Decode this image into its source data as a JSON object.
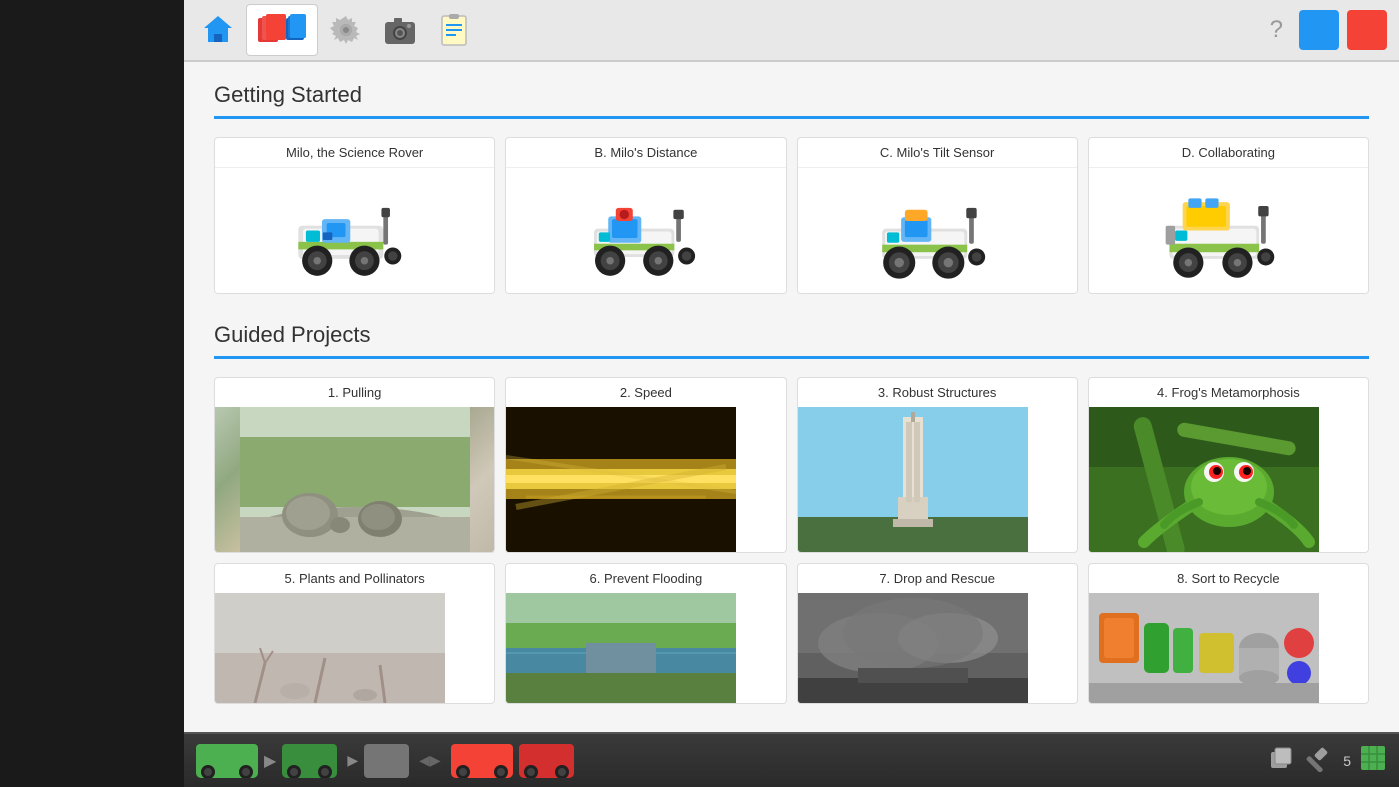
{
  "toolbar": {
    "icons": [
      "home",
      "book-open",
      "settings",
      "camera",
      "clipboard"
    ],
    "help_label": "?",
    "blue_button_label": "",
    "red_button_label": ""
  },
  "sections": {
    "getting_started": {
      "title": "Getting Started",
      "projects": [
        {
          "id": "gs1",
          "label": "Milo, the Science Rover",
          "type": "robot"
        },
        {
          "id": "gs2",
          "label": "B. Milo's Distance",
          "type": "robot"
        },
        {
          "id": "gs3",
          "label": "C. Milo's Tilt Sensor",
          "type": "robot"
        },
        {
          "id": "gs4",
          "label": "D. Collaborating",
          "type": "robot"
        }
      ]
    },
    "guided_projects": {
      "title": "Guided Projects",
      "projects": [
        {
          "id": "gp1",
          "label": "1. Pulling",
          "photo_class": "photo-rocks"
        },
        {
          "id": "gp2",
          "label": "2. Speed",
          "photo_class": "photo-speed"
        },
        {
          "id": "gp3",
          "label": "3. Robust Structures",
          "photo_class": "photo-tower"
        },
        {
          "id": "gp4",
          "label": "4. Frog's Metamorphosis",
          "photo_class": "photo-frog"
        },
        {
          "id": "gp5",
          "label": "5. Plants and Pollinators",
          "photo_class": "photo-plants"
        },
        {
          "id": "gp6",
          "label": "6. Prevent Flooding",
          "photo_class": "photo-flood"
        },
        {
          "id": "gp7",
          "label": "7. Drop and Rescue",
          "photo_class": "photo-drop"
        },
        {
          "id": "gp8",
          "label": "8. Sort to Recycle",
          "photo_class": "photo-recycle"
        }
      ]
    }
  },
  "bottom_bar": {
    "page_number": "5"
  }
}
